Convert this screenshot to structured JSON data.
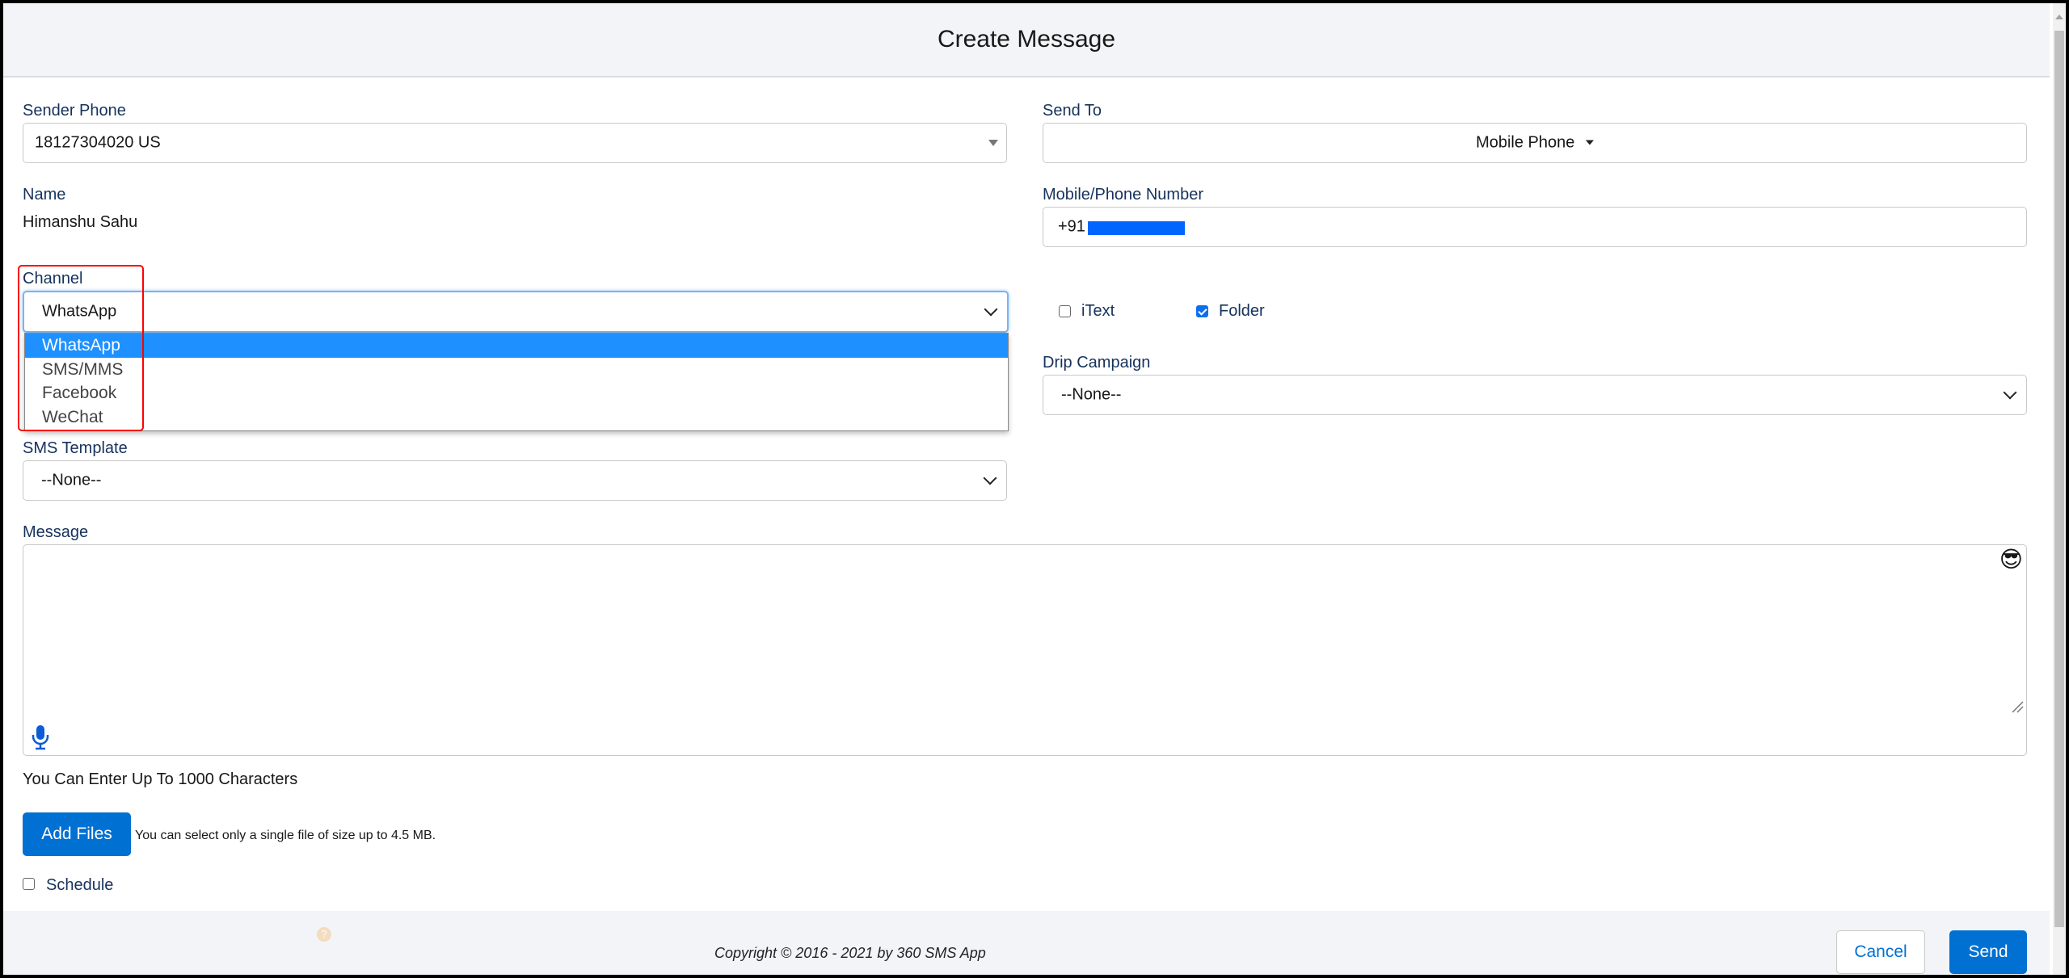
{
  "modal": {
    "title": "Create Message"
  },
  "sender_phone": {
    "label": "Sender Phone",
    "value": "18127304020 US"
  },
  "name": {
    "label": "Name",
    "value": "Himanshu Sahu"
  },
  "channel": {
    "label": "Channel",
    "value": "WhatsApp",
    "options": [
      "WhatsApp",
      "SMS/MMS",
      "Facebook",
      "WeChat"
    ],
    "highlighted": "WhatsApp"
  },
  "sms_template": {
    "label": "SMS Template",
    "value": "--None--"
  },
  "send_to": {
    "label": "Send To",
    "value": "Mobile Phone"
  },
  "mobile_number": {
    "label": "Mobile/Phone Number",
    "value": "+91"
  },
  "checkboxes": {
    "itext": {
      "label": "iText",
      "checked": false
    },
    "folder": {
      "label": "Folder",
      "checked": true
    }
  },
  "drip_campaign": {
    "label": "Drip Campaign",
    "value": "--None--"
  },
  "message": {
    "label": "Message",
    "value": "",
    "char_limit_text": "You Can Enter Up To 1000 Characters",
    "emoji": "😎"
  },
  "attachments": {
    "button_label": "Add Files",
    "hint": "You can select only a single file of size up to 4.5 MB."
  },
  "schedule": {
    "label": "Schedule",
    "checked": false
  },
  "footer": {
    "copyright": "Copyright © 2016 - 2021 by 360 SMS App",
    "help_icon": "?",
    "cancel_label": "Cancel",
    "send_label": "Send"
  },
  "colors": {
    "primary": "#0070d2",
    "label": "#16325c",
    "dropdown_highlight": "#1e90ff",
    "annotation_red": "#ff0000"
  }
}
